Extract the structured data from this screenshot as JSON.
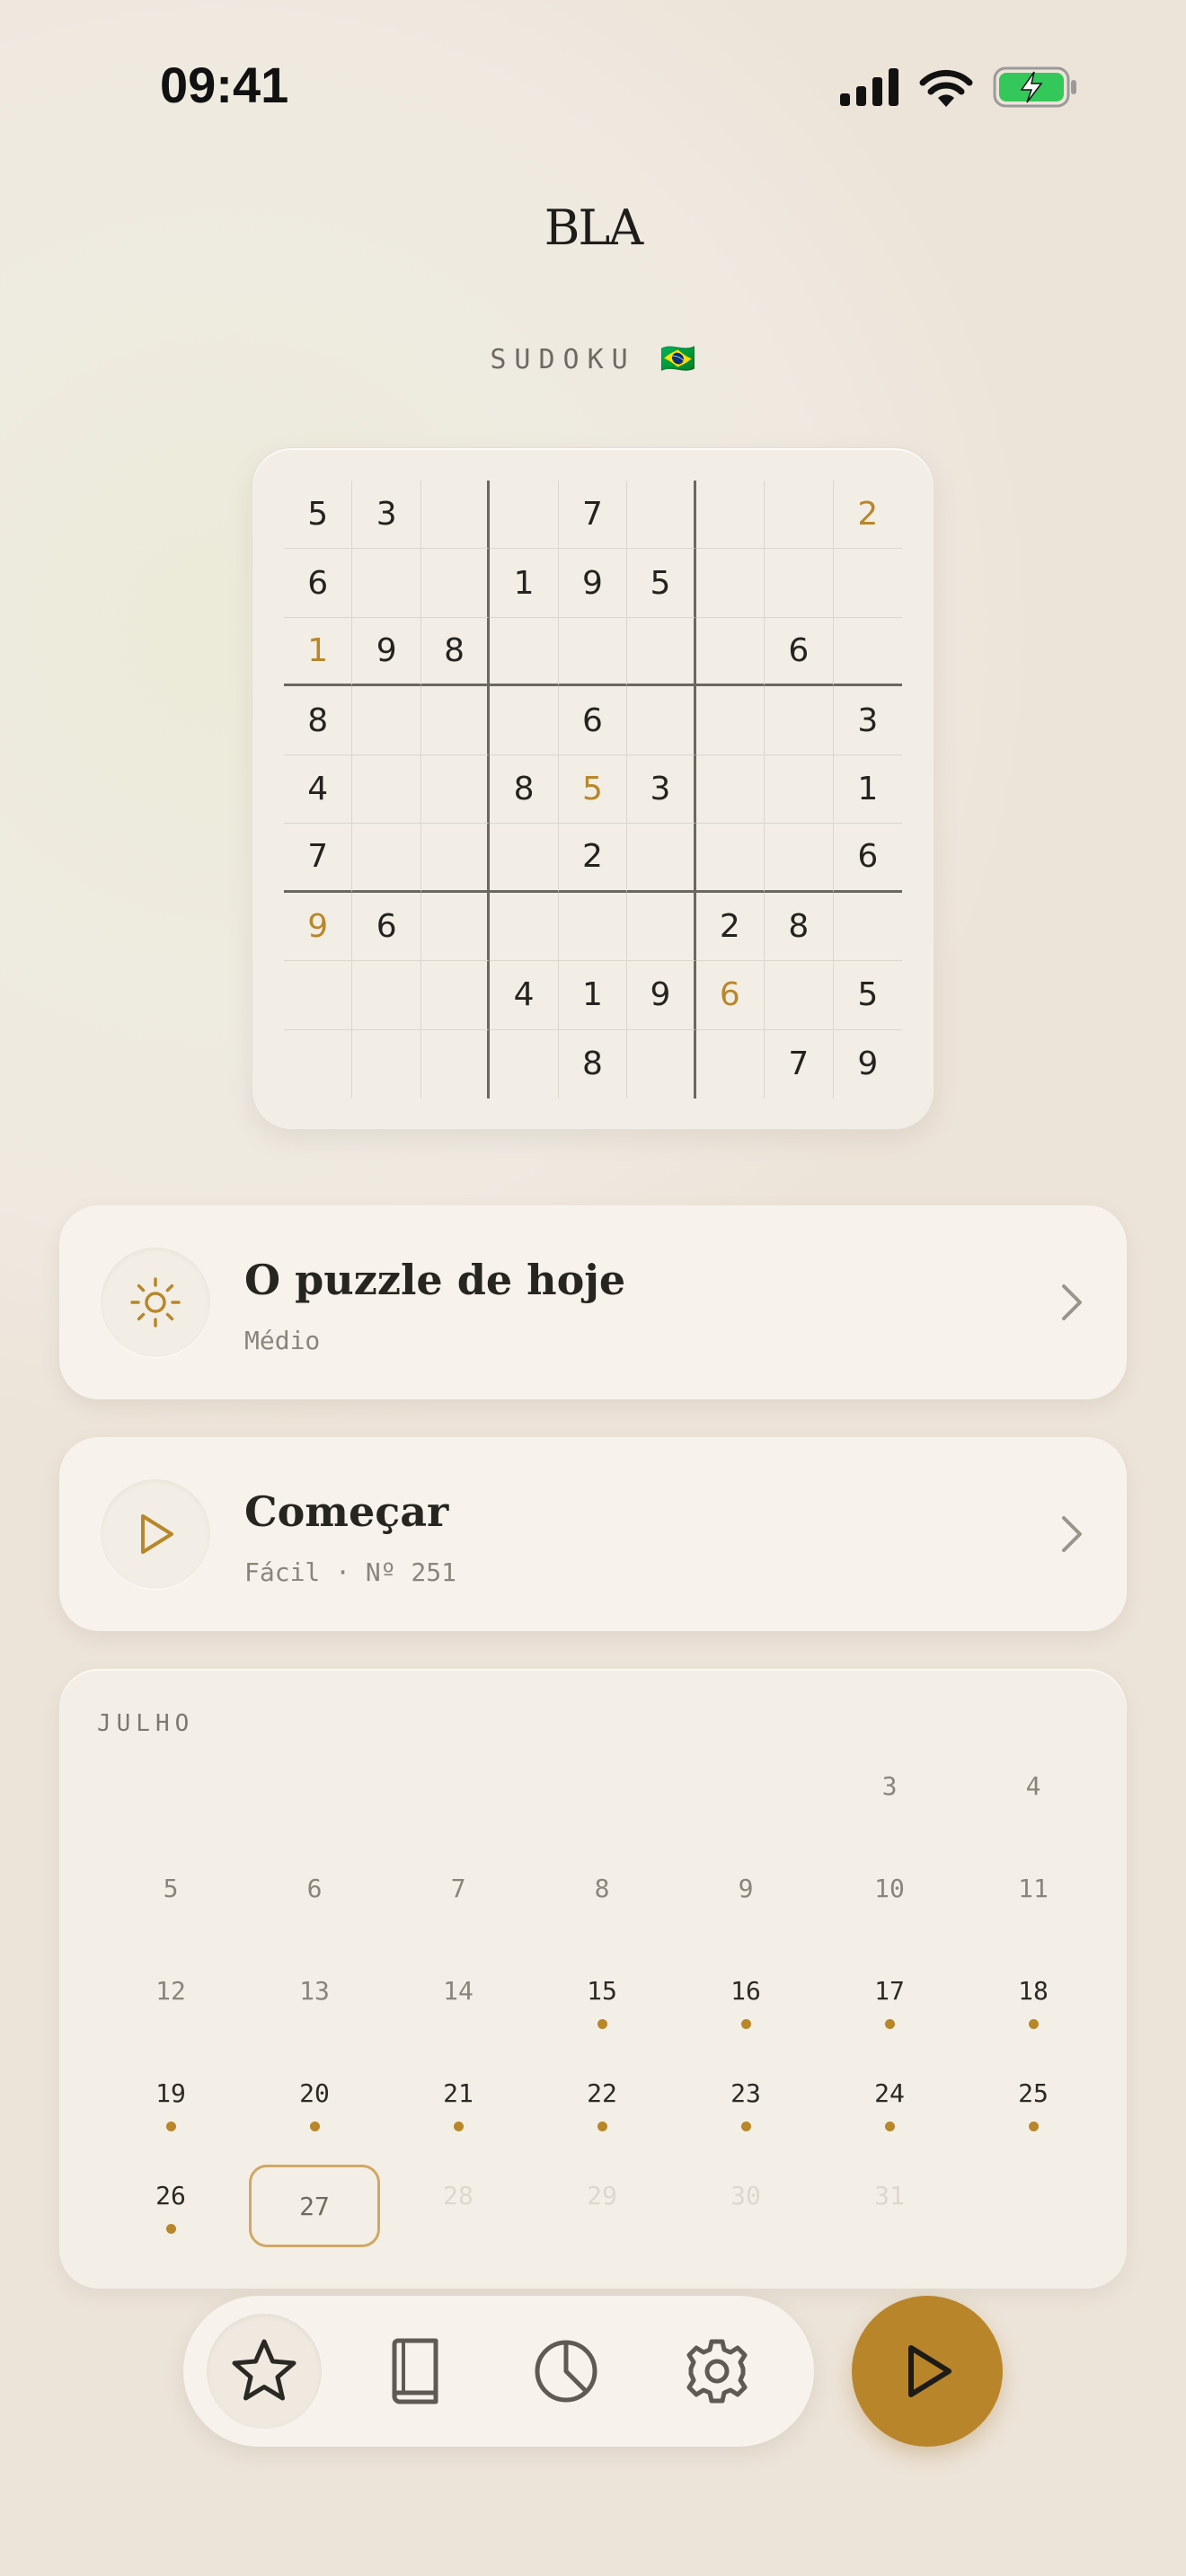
{
  "status_bar": {
    "time": "09:41",
    "icons": [
      "signal-icon",
      "wifi-icon",
      "battery-charging-icon"
    ]
  },
  "header": {
    "brand": "BLA",
    "subtitle": "SUDOKU",
    "flag": "🇧🇷"
  },
  "puzzle": {
    "accent_color": "#b8872a",
    "cells": [
      [
        "5",
        "3",
        "",
        "",
        "7",
        "",
        "",
        "",
        "2"
      ],
      [
        "6",
        "",
        "",
        "1",
        "9",
        "5",
        "",
        "",
        ""
      ],
      [
        "1",
        "9",
        "8",
        "",
        "",
        "",
        "",
        "6",
        ""
      ],
      [
        "8",
        "",
        "",
        "",
        "6",
        "",
        "",
        "",
        "3"
      ],
      [
        "4",
        "",
        "",
        "8",
        "5",
        "3",
        "",
        "",
        "1"
      ],
      [
        "7",
        "",
        "",
        "",
        "2",
        "",
        "",
        "",
        "6"
      ],
      [
        "9",
        "6",
        "",
        "",
        "",
        "",
        "2",
        "8",
        ""
      ],
      [
        "",
        "",
        "",
        "4",
        "1",
        "9",
        "6",
        "",
        "5"
      ],
      [
        "",
        "",
        "",
        "",
        "8",
        "",
        "",
        "7",
        "9"
      ]
    ],
    "accent_cells": [
      [
        0,
        8
      ],
      [
        2,
        0
      ],
      [
        4,
        4
      ],
      [
        6,
        0
      ],
      [
        7,
        6
      ]
    ]
  },
  "cards": {
    "today": {
      "title": "O puzzle de hoje",
      "subtitle": "Médio",
      "icon": "sun-icon"
    },
    "start": {
      "title": "Começar",
      "subtitle": "Fácil · Nº 251",
      "icon": "play-outline-icon"
    }
  },
  "calendar": {
    "month": "JULHO",
    "leading_blanks": 5,
    "today": 27,
    "days": [
      {
        "n": "3",
        "state": "past"
      },
      {
        "n": "4",
        "state": "past"
      },
      {
        "n": "5",
        "state": "past"
      },
      {
        "n": "6",
        "state": "past"
      },
      {
        "n": "7",
        "state": "past"
      },
      {
        "n": "8",
        "state": "past"
      },
      {
        "n": "9",
        "state": "past"
      },
      {
        "n": "10",
        "state": "past"
      },
      {
        "n": "11",
        "state": "past"
      },
      {
        "n": "12",
        "state": "past"
      },
      {
        "n": "13",
        "state": "past"
      },
      {
        "n": "14",
        "state": "past"
      },
      {
        "n": "15",
        "state": "played"
      },
      {
        "n": "16",
        "state": "played"
      },
      {
        "n": "17",
        "state": "played"
      },
      {
        "n": "18",
        "state": "played"
      },
      {
        "n": "19",
        "state": "played"
      },
      {
        "n": "20",
        "state": "played"
      },
      {
        "n": "21",
        "state": "played"
      },
      {
        "n": "22",
        "state": "played"
      },
      {
        "n": "23",
        "state": "played"
      },
      {
        "n": "24",
        "state": "played"
      },
      {
        "n": "25",
        "state": "played"
      },
      {
        "n": "26",
        "state": "played"
      },
      {
        "n": "27",
        "state": "today"
      },
      {
        "n": "28",
        "state": "future"
      },
      {
        "n": "29",
        "state": "future"
      },
      {
        "n": "30",
        "state": "future"
      },
      {
        "n": "31",
        "state": "future"
      }
    ]
  },
  "tabbar": {
    "active": "favorites",
    "tabs": [
      {
        "id": "favorites",
        "icon": "star-icon"
      },
      {
        "id": "library",
        "icon": "book-icon"
      },
      {
        "id": "stats",
        "icon": "pie-chart-icon"
      },
      {
        "id": "settings",
        "icon": "gear-icon"
      }
    ],
    "fab_icon": "play-icon"
  }
}
